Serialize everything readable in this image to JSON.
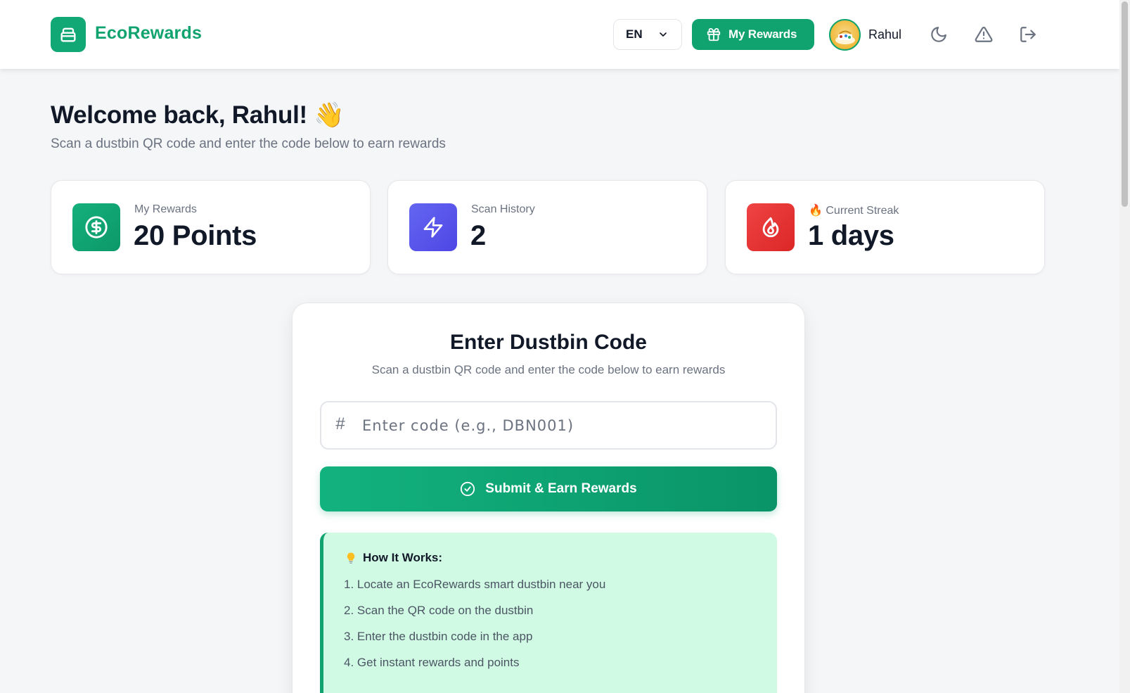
{
  "header": {
    "brand": "EcoRewards",
    "language": "EN",
    "rewards_button": "My Rewards",
    "username": "Rahul",
    "icons": [
      "bag-icon",
      "chevron-down-icon",
      "gift-icon",
      "moon-icon",
      "alert-triangle-icon",
      "logout-icon"
    ]
  },
  "welcome": {
    "title": "Welcome back, Rahul! 👋",
    "subtitle": "Scan a dustbin QR code and enter the code below to earn rewards"
  },
  "stats": [
    {
      "label": "My Rewards",
      "value": "20 Points",
      "icon": "dollar-circle-icon",
      "color": "#10a36f"
    },
    {
      "label": "Scan History",
      "value": "2",
      "icon": "lightning-icon",
      "color": "#5b50e6"
    },
    {
      "label": "🔥 Current Streak",
      "value": "1 days",
      "icon": "flame-icon",
      "color": "#e02a2a"
    }
  ],
  "code_entry": {
    "title": "Enter Dustbin Code",
    "subtitle": "Scan a dustbin QR code and enter the code below to earn rewards",
    "hash_symbol": "#",
    "input_value": "",
    "input_placeholder": "Enter code (e.g., DBN001)",
    "submit_label": "Submit & Earn Rewards"
  },
  "how_it_works": {
    "title": "How It Works:",
    "steps": [
      "1. Locate an EcoRewards smart dustbin near you",
      "2. Scan the QR code on the dustbin",
      "3. Enter the dustbin code in the app",
      "4. Get instant rewards and points"
    ]
  },
  "colors": {
    "brand": "#10a36f",
    "page_bg": "#f5f6f7",
    "how_bg": "#d1fae5"
  }
}
